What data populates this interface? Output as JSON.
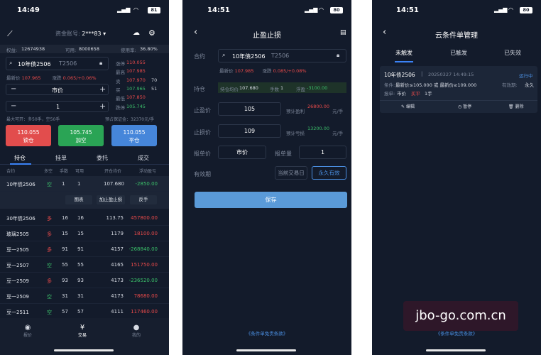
{
  "p1": {
    "time": "14:49",
    "battery": "81",
    "account_label": "资金账号:",
    "account_value": "2***83",
    "info": {
      "equity_l": "权益:",
      "equity": "12674938",
      "avail_l": "可用:",
      "avail": "8000658",
      "rate_l": "使用率:",
      "rate": "36.80%"
    },
    "contract": {
      "name": "10年债2506",
      "code": "T2506"
    },
    "last_l": "最新价",
    "last": "107.965",
    "chg_l": "涨跌",
    "chg": "0.065/+0.06%",
    "book": [
      {
        "l": "涨停",
        "v": "110.055",
        "n": ""
      },
      {
        "l": "最高",
        "v": "107.985",
        "n": ""
      },
      {
        "l": "卖",
        "v": "107.970",
        "n": "70"
      },
      {
        "l": "买",
        "v": "107.965",
        "n": "51"
      },
      {
        "l": "最低",
        "v": "107.850",
        "n": ""
      },
      {
        "l": "跌停",
        "v": "105.745",
        "n": ""
      }
    ],
    "price_mode": "市价",
    "qty": "1",
    "max_open": "最大可开：多50手，空50手",
    "margin": "预占保证金：32370元/手",
    "btn_long_price": "110.055",
    "btn_long": "锁仓",
    "btn_short_price": "105.745",
    "btn_short": "加空",
    "btn_close_price": "110.055",
    "btn_close": "平仓",
    "tabs": [
      "持仓",
      "挂单",
      "委托",
      "成交"
    ],
    "cols": [
      "合约",
      "多空",
      "手数",
      "可用",
      "开仓均价",
      "浮动盈亏"
    ],
    "rows": [
      {
        "c": "10年债2506",
        "d": "空",
        "q": "1",
        "a": "1",
        "p": "107.680",
        "pl": "-2850.00"
      },
      {
        "c": "30年债2506",
        "d": "多",
        "q": "16",
        "a": "16",
        "p": "113.75",
        "pl": "457800.00"
      },
      {
        "c": "玻璃2505",
        "d": "多",
        "q": "15",
        "a": "15",
        "p": "1179",
        "pl": "18100.00"
      },
      {
        "c": "豆一2505",
        "d": "多",
        "q": "91",
        "a": "91",
        "p": "4157",
        "pl": "-268840.00"
      },
      {
        "c": "豆一2507",
        "d": "空",
        "q": "55",
        "a": "55",
        "p": "4165",
        "pl": "151750.00"
      },
      {
        "c": "豆一2509",
        "d": "多",
        "q": "93",
        "a": "93",
        "p": "4173",
        "pl": "-236520.00"
      },
      {
        "c": "豆一2509",
        "d": "空",
        "q": "31",
        "a": "31",
        "p": "4173",
        "pl": "78680.00"
      },
      {
        "c": "豆一2511",
        "d": "空",
        "q": "57",
        "a": "57",
        "p": "4111",
        "pl": "117460.00"
      }
    ],
    "row_actions": [
      "图表",
      "加止盈止损",
      "反手"
    ],
    "nav": [
      "报价",
      "交易",
      "我的"
    ]
  },
  "p2": {
    "time": "14:51",
    "battery": "80",
    "title": "止盈止损",
    "contract_l": "合约",
    "contract": {
      "name": "10年债2506",
      "code": "T2506"
    },
    "last_l": "最新价",
    "last": "107.985",
    "chg_l": "涨跌",
    "chg": "0.085/+0.08%",
    "pos_l": "持仓",
    "pos_avg_l": "持仓均价",
    "pos_avg": "107.680",
    "pos_qty_l": "手数",
    "pos_qty": "1",
    "pos_pl_l": "浮盈",
    "pos_pl": "-3100.00",
    "tp_l": "止盈价",
    "tp": "105",
    "tp_est_l": "预计盈利",
    "tp_est": "26800.00",
    "tp_unit": "元/手",
    "sl_l": "止损价",
    "sl": "109",
    "sl_est_l": "预计亏损",
    "sl_est": "13200.00",
    "sl_unit": "元/手",
    "order_price_l": "报单价",
    "order_price": "市价",
    "order_qty_l": "报单量",
    "order_qty": "1",
    "valid_l": "有效期",
    "valid_opt1": "当前交易日",
    "valid_opt2": "永久有效",
    "save": "保存",
    "terms": "《条件单免责条款》"
  },
  "p3": {
    "time": "14:51",
    "battery": "80",
    "title": "云条件单管理",
    "tabs": [
      "未触发",
      "已触发",
      "已失效"
    ],
    "card": {
      "name": "10年债2506",
      "date": "20250327 14:49:15",
      "status": "运行中",
      "cond_l": "条件:",
      "cond": "最新价≤105.000 或 最新价≥109.000",
      "valid_l": "有效期:",
      "valid": "永久",
      "order_l": "报单:",
      "order_a": "市价",
      "order_b": "买平",
      "order_c": "1手"
    },
    "actions": [
      "编辑",
      "暂停",
      "删除"
    ],
    "terms": "《条件单免责条款》"
  },
  "watermark": "jbo-go.com.cn"
}
